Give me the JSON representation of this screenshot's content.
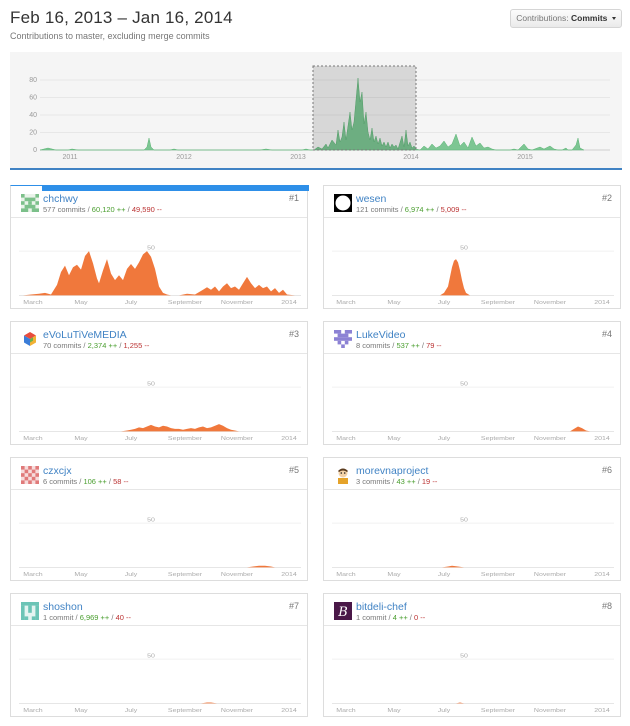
{
  "header": {
    "date_range": "Feb 16, 2013 – Jan 16, 2014",
    "subtitle": "Contributions to master, excluding merge commits"
  },
  "contrib_select": {
    "label": "Contributions:",
    "value": "Commits"
  },
  "overview": {
    "y_ticks": [
      "80",
      "60",
      "40",
      "20",
      "0"
    ],
    "x_ticks": [
      "2011",
      "2012",
      "2013",
      "2014",
      "2015"
    ],
    "fill_color": "#7dc693"
  },
  "card_axis": {
    "y_tick": "50",
    "x_ticks": [
      "March",
      "May",
      "July",
      "September",
      "November",
      "2014"
    ]
  },
  "colors": {
    "accent": "#4183c4",
    "area": "#f0783c",
    "additions": "#4a9e2f",
    "deletions": "#b33333"
  },
  "contributors": [
    {
      "name": "chchwy",
      "commits": "577 commits",
      "additions": "60,120 ++",
      "deletions": "49,590 --",
      "rank": "#1",
      "avatar_icon": "identicon-green-icon"
    },
    {
      "name": "wesen",
      "commits": "121 commits",
      "additions": "6,974 ++",
      "deletions": "5,009 --",
      "rank": "#2",
      "avatar_icon": "black-circle-avatar-icon"
    },
    {
      "name": "eVoLuTiVeMEDIA",
      "commits": "70 commits",
      "additions": "2,374 ++",
      "deletions": "1,255 --",
      "rank": "#3",
      "avatar_icon": "multicolor-cube-icon"
    },
    {
      "name": "LukeVideo",
      "commits": "8 commits",
      "additions": "537 ++",
      "deletions": "79 --",
      "rank": "#4",
      "avatar_icon": "identicon-purple-icon"
    },
    {
      "name": "czxcjx",
      "commits": "6 commits",
      "additions": "106 ++",
      "deletions": "58 --",
      "rank": "#5",
      "avatar_icon": "identicon-red-icon"
    },
    {
      "name": "morevnaproject",
      "commits": "3 commits",
      "additions": "43 ++",
      "deletions": "19 --",
      "rank": "#6",
      "avatar_icon": "cartoon-character-icon"
    },
    {
      "name": "shoshon",
      "commits": "1 commit",
      "additions": "6,969 ++",
      "deletions": "40 --",
      "rank": "#7",
      "avatar_icon": "identicon-teal-icon"
    },
    {
      "name": "bitdeli-chef",
      "commits": "1 commit",
      "additions": "4 ++",
      "deletions": "0 --",
      "rank": "#8",
      "avatar_icon": "bitdeli-logo-icon"
    }
  ]
}
